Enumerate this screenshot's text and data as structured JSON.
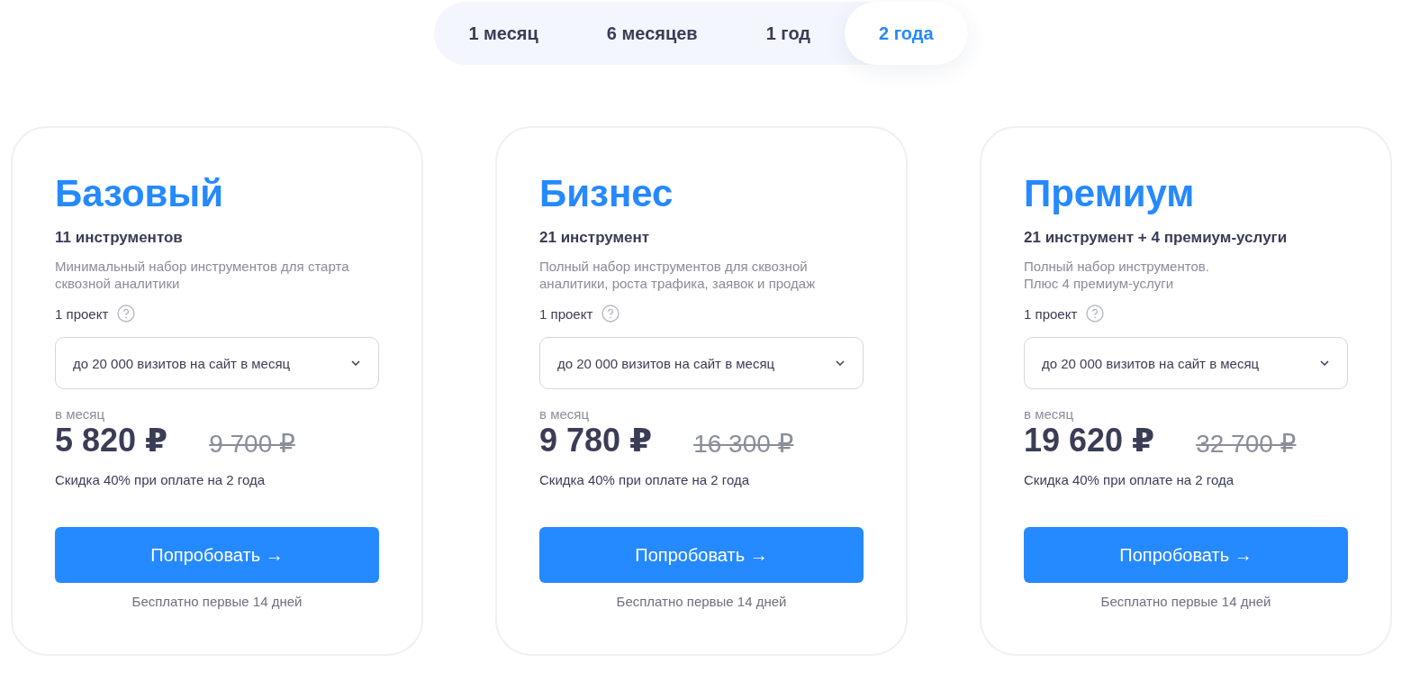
{
  "periods": [
    {
      "label": "1 месяц",
      "selected": false
    },
    {
      "label": "6 месяцев",
      "selected": false
    },
    {
      "label": "1 год",
      "selected": false
    },
    {
      "label": "2 года",
      "selected": true
    }
  ],
  "plans": [
    {
      "name": "Базовый",
      "tools": "11 инструментов",
      "description": "Минимальный набор инструментов для старта сквозной аналитики",
      "projects": "1 проект",
      "visits": "до 20 000 визитов на сайт в месяц",
      "per": "в месяц",
      "price": "5 820 ₽",
      "old_price": "9 700 ₽",
      "discount": "Скидка 40% при оплате на 2 года",
      "button": "Попробовать →",
      "trial": "Бесплатно первые 14 дней"
    },
    {
      "name": "Бизнес",
      "tools": "21 инструмент",
      "description": "Полный набор инструментов для сквозной аналитики, роста трафика, заявок и продаж",
      "projects": "1 проект",
      "visits": "до 20 000 визитов на сайт в месяц",
      "per": "в месяц",
      "price": "9 780 ₽",
      "old_price": "16 300 ₽",
      "discount": "Скидка 40% при оплате на 2 года",
      "button": "Попробовать →",
      "trial": "Бесплатно первые 14 дней"
    },
    {
      "name": "Премиум",
      "tools": "21 инструмент + 4 премиум-услуги",
      "description": "Полный набор инструментов.\nПлюс 4 премиум-услуги",
      "projects": "1 проект",
      "visits": "до 20 000 визитов на сайт в месяц",
      "per": "в месяц",
      "price": "19 620 ₽",
      "old_price": "32 700 ₽",
      "discount": "Скидка 40% при оплате на 2 года",
      "button": "Попробовать →",
      "trial": "Бесплатно первые 14 дней"
    }
  ]
}
